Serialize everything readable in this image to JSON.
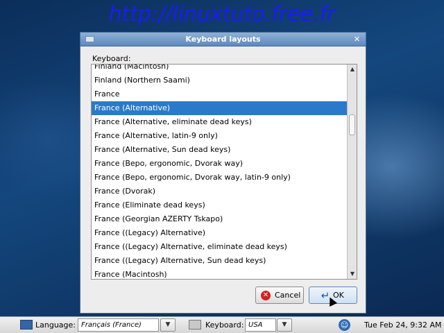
{
  "watermark": "http://linuxtuto.free.fr",
  "dialog": {
    "title": "Keyboard layouts",
    "list_label": "Keyboard:",
    "items": [
      "Finland (Macintosh)",
      "Finland (Northern Saami)",
      "France",
      "France (Alternative)",
      "France (Alternative, eliminate dead keys)",
      "France (Alternative, latin-9 only)",
      "France (Alternative, Sun dead keys)",
      "France (Bepo, ergonomic, Dvorak way)",
      "France (Bepo, ergonomic, Dvorak way, latin-9 only)",
      "France (Dvorak)",
      "France (Eliminate dead keys)",
      "France (Georgian AZERTY Tskapo)",
      "France ((Legacy) Alternative)",
      "France ((Legacy) Alternative, eliminate dead keys)",
      "France ((Legacy) Alternative, Sun dead keys)",
      "France (Macintosh)"
    ],
    "selected_index": 3,
    "cancel_label": "Cancel",
    "ok_label": "OK",
    "cancel_icon": "cancel-icon",
    "ok_icon": "enter-icon"
  },
  "taskbar": {
    "language_label": "Language:",
    "language_value": "Français (France)",
    "keyboard_label": "Keyboard:",
    "keyboard_value": "USA",
    "clock": "Tue Feb 24,  9:32 AM",
    "icons": [
      "flag-icon",
      "keyboard-icon",
      "accessibility-icon"
    ]
  },
  "colors": {
    "selection": "#2b7ac9",
    "titlebar": "#5e89bf",
    "watermark": "#1c1cf0"
  }
}
